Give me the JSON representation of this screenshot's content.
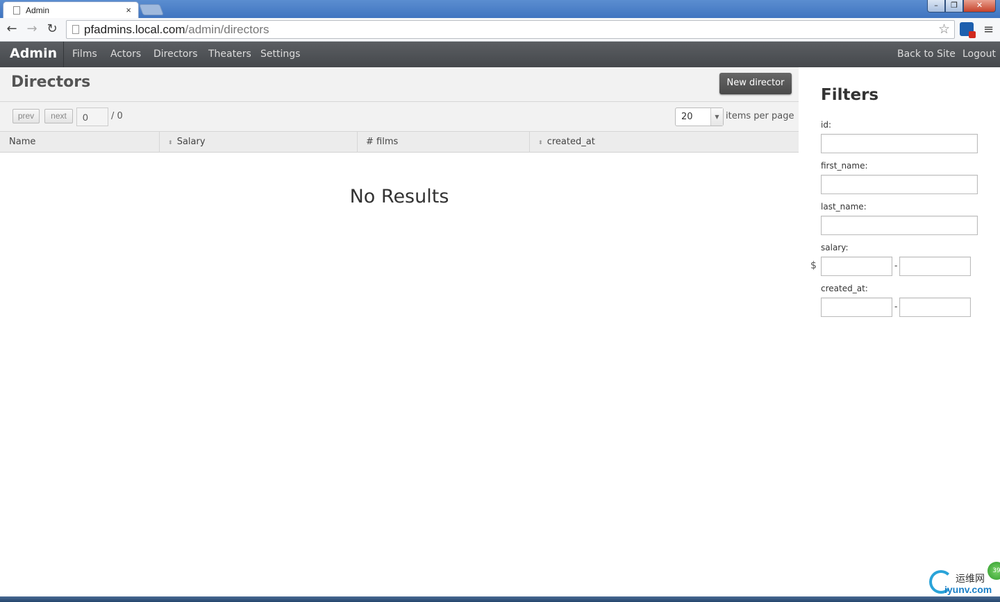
{
  "browser": {
    "tab_title": "Admin",
    "tab_close": "×",
    "url_host": "pfadmins.local.com",
    "url_path": "/admin/directors",
    "win_min": "–",
    "win_max": "❐",
    "win_close": "✕"
  },
  "navbar": {
    "brand": "Admin",
    "links": [
      "Films",
      "Actors",
      "Directors",
      "Theaters",
      "Settings"
    ],
    "right_links": [
      "Back to Site",
      "Logout"
    ]
  },
  "main": {
    "title": "Directors",
    "new_button": "New director",
    "pager": {
      "prev": "prev",
      "next": "next",
      "page_value": "0",
      "total": "/ 0",
      "per_page": "20",
      "per_page_label": "items per page"
    },
    "columns": [
      "Name",
      "Salary",
      "# films",
      "created_at"
    ],
    "empty_message": "No Results"
  },
  "filters": {
    "title": "Filters",
    "fields": [
      "id:",
      "first_name:",
      "last_name:",
      "salary:",
      "created_at:"
    ],
    "currency": "$",
    "range_sep": "-"
  },
  "watermark": {
    "text1": "运维网",
    "text2": "iyunv.com",
    "badge": "39"
  }
}
